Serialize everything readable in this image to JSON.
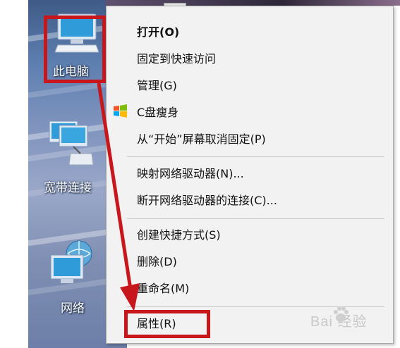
{
  "desktop": {
    "icons": [
      {
        "label": "此电脑",
        "icon": "computer-icon"
      },
      {
        "label": "宽带连接",
        "icon": "broadband-connection-icon"
      },
      {
        "label": "网络",
        "icon": "network-icon"
      }
    ]
  },
  "context_menu": {
    "items": [
      {
        "label": "打开(O)",
        "bold": true
      },
      {
        "label": "固定到快速访问"
      },
      {
        "label": "管理(G)",
        "icon": "shield-icon"
      },
      {
        "label": "C盘瘦身",
        "icon": "windows-flag-icon"
      },
      {
        "label": "从“开始”屏幕取消固定(P)"
      },
      {
        "label": "映射网络驱动器(N)..."
      },
      {
        "label": "断开网络驱动器的连接(C)..."
      },
      {
        "label": "创建快捷方式(S)"
      },
      {
        "label": "删除(D)"
      },
      {
        "label": "重命名(M)"
      },
      {
        "label": "属性(R)"
      }
    ]
  },
  "annotation": {
    "color": "#c8161d",
    "highlighted": [
      "此电脑",
      "属性(R)"
    ]
  },
  "watermark": {
    "text": "Bai 经验",
    "icon": "baidu-paw-icon"
  }
}
